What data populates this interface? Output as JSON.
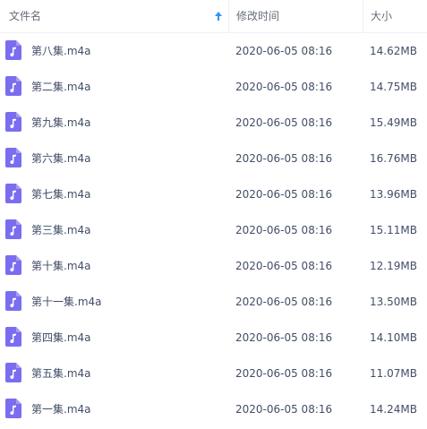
{
  "header": {
    "name_label": "文件名",
    "time_label": "修改时间",
    "size_label": "大小",
    "sort_icon": "sort-ascending-arrow-icon"
  },
  "colors": {
    "icon_purple": "#7a6df0",
    "sort_arrow_blue": "#2f94f7"
  },
  "files": [
    {
      "name": "第八集.m4a",
      "modified": "2020-06-05 08:16",
      "size": "14.62MB",
      "icon": "audio-file-icon"
    },
    {
      "name": "第二集.m4a",
      "modified": "2020-06-05 08:16",
      "size": "14.75MB",
      "icon": "audio-file-icon"
    },
    {
      "name": "第九集.m4a",
      "modified": "2020-06-05 08:16",
      "size": "15.49MB",
      "icon": "audio-file-icon"
    },
    {
      "name": "第六集.m4a",
      "modified": "2020-06-05 08:16",
      "size": "16.76MB",
      "icon": "audio-file-icon"
    },
    {
      "name": "第七集.m4a",
      "modified": "2020-06-05 08:16",
      "size": "13.96MB",
      "icon": "audio-file-icon"
    },
    {
      "name": "第三集.m4a",
      "modified": "2020-06-05 08:16",
      "size": "15.11MB",
      "icon": "audio-file-icon"
    },
    {
      "name": "第十集.m4a",
      "modified": "2020-06-05 08:16",
      "size": "12.19MB",
      "icon": "audio-file-icon"
    },
    {
      "name": "第十一集.m4a",
      "modified": "2020-06-05 08:16",
      "size": "13.50MB",
      "icon": "audio-file-icon"
    },
    {
      "name": "第四集.m4a",
      "modified": "2020-06-05 08:16",
      "size": "14.10MB",
      "icon": "audio-file-icon"
    },
    {
      "name": "第五集.m4a",
      "modified": "2020-06-05 08:16",
      "size": "11.07MB",
      "icon": "audio-file-icon"
    },
    {
      "name": "第一集.m4a",
      "modified": "2020-06-05 08:16",
      "size": "14.24MB",
      "icon": "audio-file-icon"
    }
  ]
}
